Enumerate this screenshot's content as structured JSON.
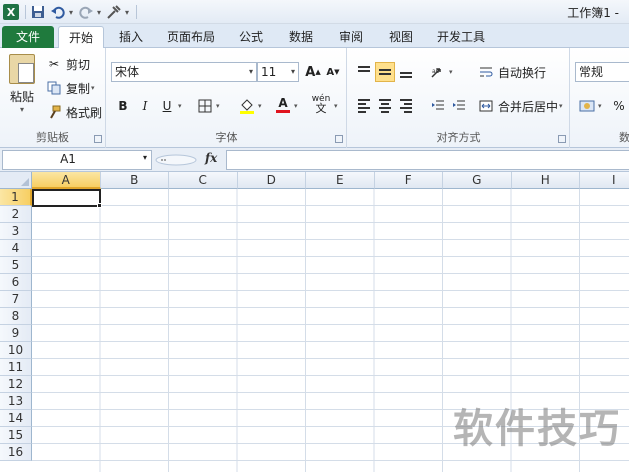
{
  "app": {
    "title": "工作簿1 -",
    "icon": "excel-icon"
  },
  "quick_access": {
    "save_icon": "save-icon",
    "undo_icon": "undo-icon",
    "redo_icon": "redo-icon",
    "customize_icon": "customize-icon"
  },
  "tabs": [
    {
      "label": "文件"
    },
    {
      "label": "开始"
    },
    {
      "label": "插入"
    },
    {
      "label": "页面布局"
    },
    {
      "label": "公式"
    },
    {
      "label": "数据"
    },
    {
      "label": "审阅"
    },
    {
      "label": "视图"
    },
    {
      "label": "开发工具"
    }
  ],
  "ribbon": {
    "clipboard": {
      "label": "剪贴板",
      "paste": "粘贴",
      "cut": "剪切",
      "copy": "复制",
      "format_painter": "格式刷"
    },
    "font": {
      "label": "字体",
      "font_name": "宋体",
      "font_size": "11",
      "bold": "B",
      "italic": "I",
      "underline": "U",
      "grow": "A",
      "shrink": "A",
      "font_color_letter": "A",
      "phonetic": "wén"
    },
    "alignment": {
      "label": "对齐方式",
      "wrap_text": "自动换行",
      "merge_center": "合并后居中"
    },
    "number": {
      "label": "数",
      "format": "常规",
      "percent": "%"
    }
  },
  "formula_bar": {
    "name_box": "A1",
    "fx": "fx",
    "value": ""
  },
  "grid": {
    "columns": [
      "A",
      "B",
      "C",
      "D",
      "E",
      "F",
      "G",
      "H",
      "I"
    ],
    "rows": [
      "1",
      "2",
      "3",
      "4",
      "5",
      "6",
      "7",
      "8",
      "9",
      "10",
      "11",
      "12",
      "13",
      "14",
      "15",
      "16"
    ],
    "active_cell": "A1"
  },
  "watermark": "软件技巧",
  "colors": {
    "file_tab": "#1f7a3d",
    "active_header": "#f7cf63",
    "grid_line": "#d4dde8"
  }
}
